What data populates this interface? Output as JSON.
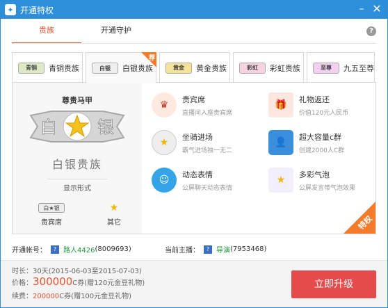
{
  "window": {
    "title": "开通特权"
  },
  "tabs": [
    {
      "label": "贵族",
      "active": true
    },
    {
      "label": "开通守护",
      "active": false
    }
  ],
  "nobles": [
    {
      "label": "青铜贵族",
      "badge": "青铜",
      "color": "#9bb36a"
    },
    {
      "label": "白银贵族",
      "badge": "白银",
      "color": "#cfcfcf",
      "selected": true,
      "tag": "荐"
    },
    {
      "label": "黄金贵族",
      "badge": "黄金",
      "color": "#e8c43a"
    },
    {
      "label": "彩虹贵族",
      "badge": "彩虹",
      "color": "#e86aa0"
    },
    {
      "label": "九五至尊",
      "badge": "至尊",
      "color": "#d15ac8"
    }
  ],
  "detail": {
    "name": "尊贵马甲",
    "rank_text": "白银贵族",
    "big_badge_text": "白 银",
    "show_form_label": "显示形式",
    "forms": [
      {
        "label": "贵宾席"
      },
      {
        "label": "其它"
      }
    ]
  },
  "features": [
    {
      "title": "贵宾席",
      "desc": "直播间入座贵宾席",
      "icon": "chair-icon"
    },
    {
      "title": "礼物返还",
      "desc": "价值120元人民币",
      "icon": "gift-icon"
    },
    {
      "title": "坐骑进场",
      "desc": "霸气进场独一无二",
      "icon": "mount-icon"
    },
    {
      "title": "超大容量c群",
      "desc": "创建2000人C群",
      "icon": "group-icon"
    },
    {
      "title": "动态表情",
      "desc": "公屏聊天动态表情",
      "icon": "emoji-icon"
    },
    {
      "title": "多彩气泡",
      "desc": "公屏发言带气泡效果",
      "icon": "bubble-icon"
    }
  ],
  "ribbon": "特权",
  "account": {
    "label": "开通帐号：",
    "user": "路人4426",
    "user_id": "(8009693)",
    "host_label": "当前主播：",
    "host": "导演",
    "host_id": "(7953468)"
  },
  "purchase": {
    "duration_label": "时长：",
    "duration_value": "30天(2015-06-03至2015-07-03)",
    "price_label": "价格：",
    "price_value": "300000",
    "price_unit": "C券(赠120元金豆礼物)",
    "renew_label": "续费：",
    "renew_value": "200000",
    "renew_unit": "C券(赠100元金豆礼物)",
    "button": "立即升级"
  }
}
